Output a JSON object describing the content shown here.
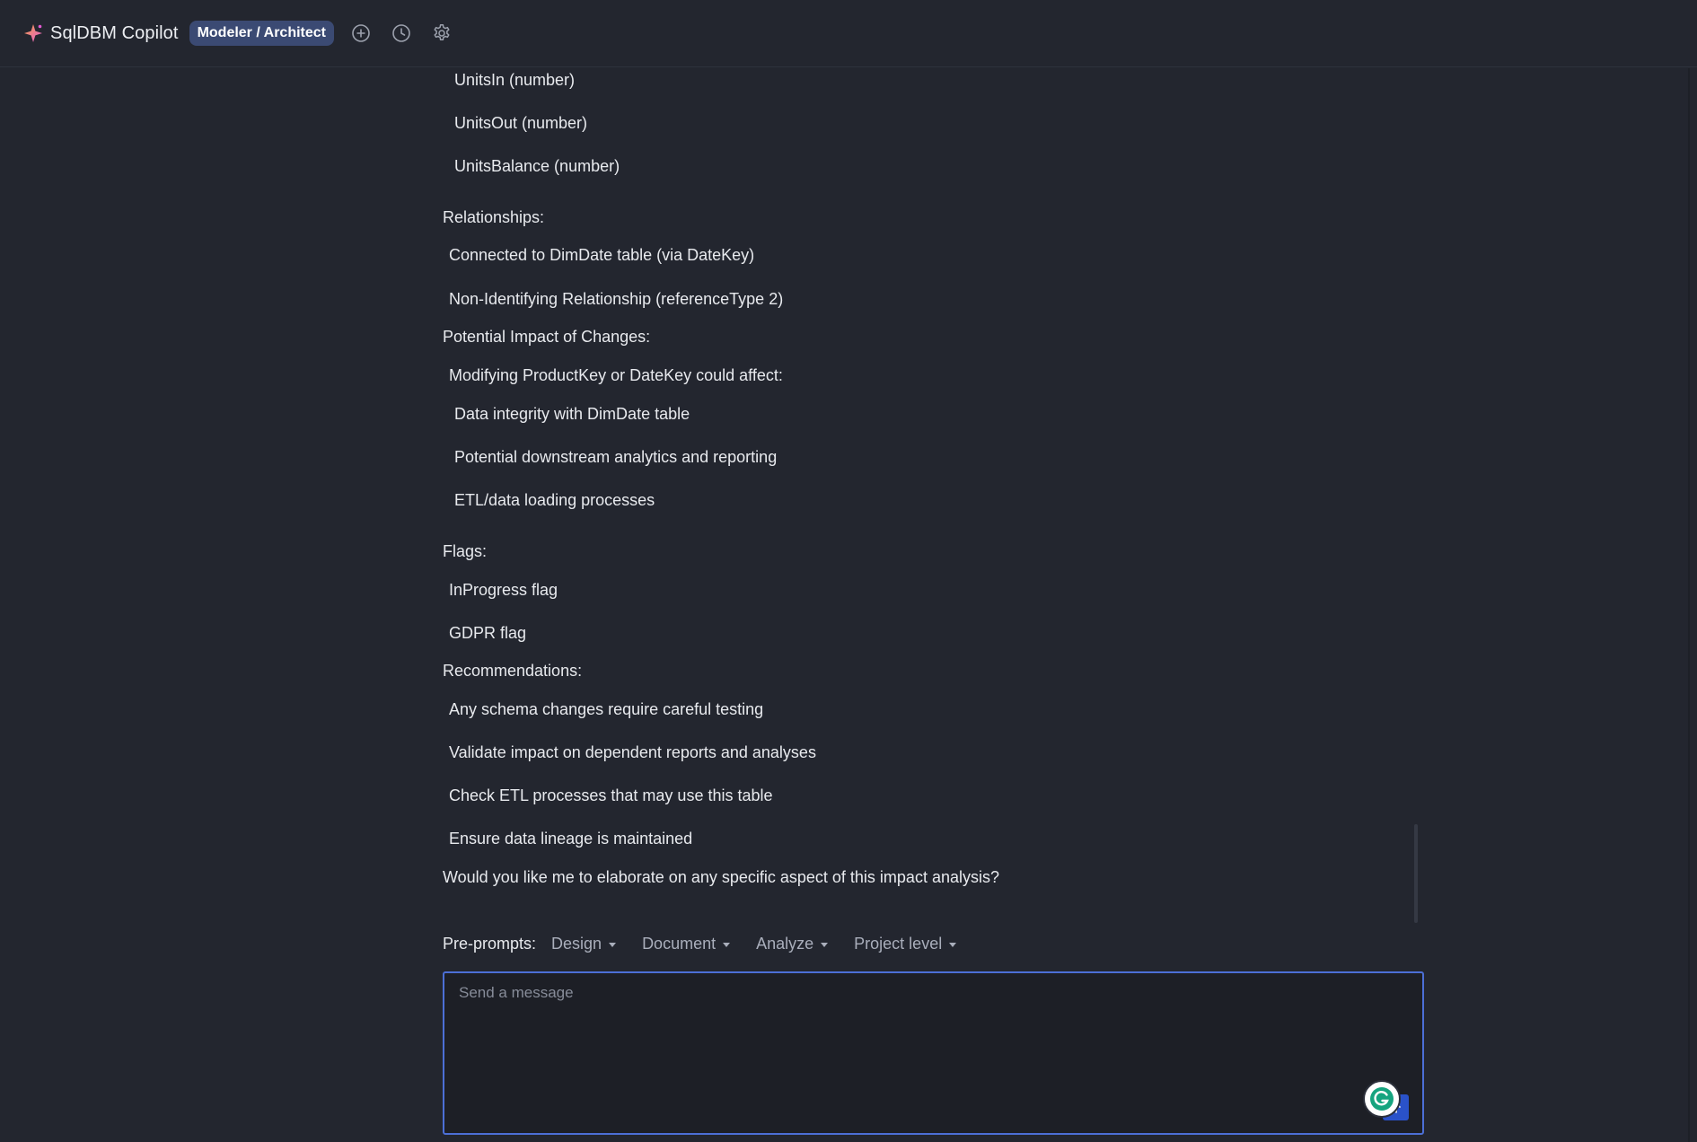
{
  "header": {
    "app_title": "SqlDBM Copilot",
    "role_badge": "Modeler / Architect",
    "icons": [
      "sparkle-logo-icon",
      "new-chat-plus-icon",
      "history-clock-icon",
      "settings-gear-icon"
    ]
  },
  "colors": {
    "background": "#23262f",
    "badge": "#3b4a73",
    "input_border": "#4c6fd6",
    "send_button": "#2a52c9",
    "logo_orange": "#f5a04a",
    "logo_pink": "#e25ad1"
  },
  "chat": {
    "lines": [
      {
        "text": "UnitsIn (number)"
      },
      {
        "text": "UnitsOut (number)"
      },
      {
        "text": "UnitsBalance (number)"
      },
      {
        "text": "Relationships:"
      },
      {
        "text": "Connected to DimDate table (via DateKey)"
      },
      {
        "text": "Non-Identifying Relationship (referenceType 2)"
      },
      {
        "text": "Potential Impact of Changes:"
      },
      {
        "text": "Modifying ProductKey or DateKey could affect:"
      },
      {
        "text": "Data integrity with DimDate table"
      },
      {
        "text": "Potential downstream analytics and reporting"
      },
      {
        "text": "ETL/data loading processes"
      },
      {
        "text": "Flags:"
      },
      {
        "text": "InProgress flag"
      },
      {
        "text": "GDPR flag"
      },
      {
        "text": "Recommendations:"
      },
      {
        "text": "Any schema changes require careful testing"
      },
      {
        "text": "Validate impact on dependent reports and analyses"
      },
      {
        "text": "Check ETL processes that may use this table"
      },
      {
        "text": "Ensure data lineage is maintained"
      },
      {
        "text": "Would you like me to elaborate on any specific aspect of this impact analysis?"
      }
    ]
  },
  "preprompts": {
    "label": "Pre-prompts:",
    "items": [
      {
        "label": "Design"
      },
      {
        "label": "Document"
      },
      {
        "label": "Analyze"
      },
      {
        "label": "Project level"
      }
    ]
  },
  "composer": {
    "placeholder": "Send a message",
    "value": ""
  }
}
